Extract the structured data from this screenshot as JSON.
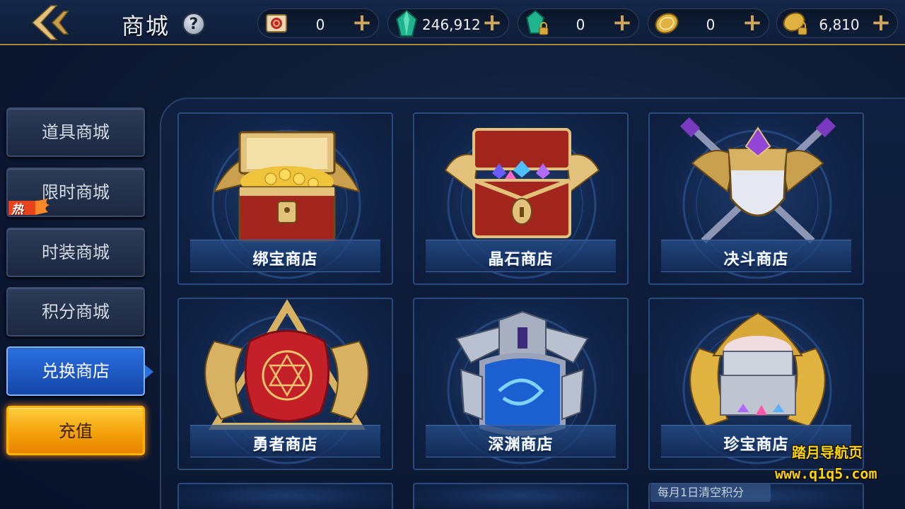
{
  "header": {
    "title": "商城",
    "help_label": "?",
    "currencies": [
      {
        "name": "scroll-ticket-icon",
        "value": "0",
        "plus": "+"
      },
      {
        "name": "crystal-icon",
        "value": "246,912",
        "plus": "+"
      },
      {
        "name": "bound-crystal-icon",
        "value": "0",
        "plus": "+"
      },
      {
        "name": "gold-coin-icon",
        "value": "0",
        "plus": "+"
      },
      {
        "name": "bound-gold-coin-icon",
        "value": "6,810",
        "plus": "+"
      }
    ]
  },
  "sidebar": {
    "items": [
      {
        "label": "道具商城"
      },
      {
        "label": "限时商城"
      },
      {
        "label": "时装商城"
      },
      {
        "label": "积分商城"
      },
      {
        "label": "兑换商店"
      }
    ],
    "hot_badge": "热",
    "recharge_label": "充值"
  },
  "shops": [
    {
      "label": "绑宝商店",
      "icon": "gold-treasure-chest-icon"
    },
    {
      "label": "晶石商店",
      "icon": "gem-treasure-chest-icon"
    },
    {
      "label": "决斗商店",
      "icon": "crossed-swords-shield-icon"
    },
    {
      "label": "勇者商店",
      "icon": "winged-seal-emblem-icon"
    },
    {
      "label": "深渊商店",
      "icon": "abyss-portal-icon"
    },
    {
      "label": "珍宝商店",
      "icon": "winged-jewel-box-icon"
    }
  ],
  "notes": {
    "monthly_reset": "每月1日清空积分"
  },
  "watermark": {
    "line1": "踏月导航页",
    "line2": "www.q1q5.com"
  },
  "colors": {
    "accent_gold": "#cfa65a",
    "active_tab": "#2a6fe0",
    "recharge": "#f2a10b"
  }
}
